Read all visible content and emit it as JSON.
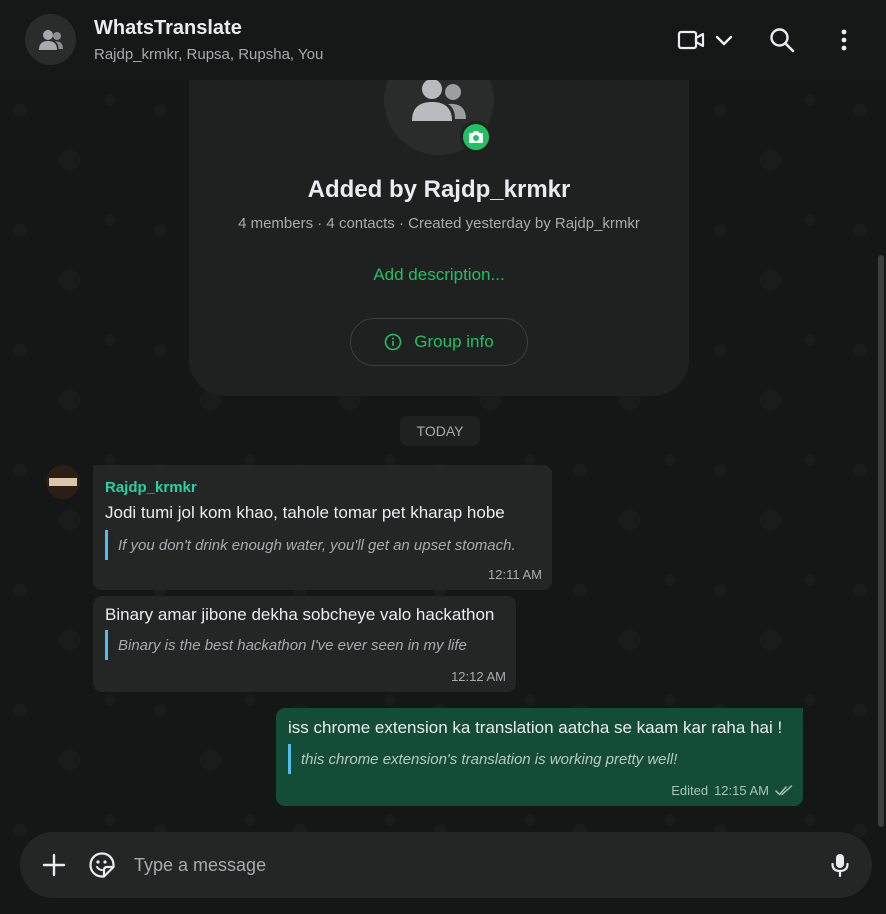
{
  "header": {
    "title": "WhatsTranslate",
    "subtitle": "Rajdp_krmkr, Rupsa, Rupsha, You",
    "icons": [
      "group-avatar-icon",
      "video-call-icon",
      "chevron-down-icon",
      "search-icon",
      "more-options-icon"
    ]
  },
  "group_card": {
    "name": "Added by Rajdp_krmkr",
    "meta": "4 members · 4 contacts · Created yesterday by Rajdp_krmkr",
    "add_description": "Add description...",
    "group_info_label": "Group info"
  },
  "date_divider": "TODAY",
  "messages": [
    {
      "direction": "in",
      "sender": "Rajdp_krmkr",
      "text": "Jodi tumi jol kom khao, tahole tomar pet kharap hobe",
      "translation": "If you don't drink enough water, you'll get an upset stomach.",
      "time": "12:11 AM"
    },
    {
      "direction": "in",
      "text": "Binary amar jibone dekha sobcheye valo hackathon",
      "translation": "Binary is the best hackathon I've ever seen in my life",
      "time": "12:12 AM"
    },
    {
      "direction": "out",
      "text": "iss chrome extension ka translation aatcha se kaam kar raha hai !",
      "translation": "this chrome extension's translation is working pretty well!",
      "edited": "Edited",
      "time": "12:15 AM",
      "status": "read"
    }
  ],
  "composer": {
    "placeholder": "Type a message"
  },
  "colors": {
    "accent": "#21c063",
    "sender_name": "#25d3a5",
    "outgoing_bubble": "#144d37",
    "incoming_bubble": "#242626",
    "translation_bar": "#53bdeb"
  }
}
